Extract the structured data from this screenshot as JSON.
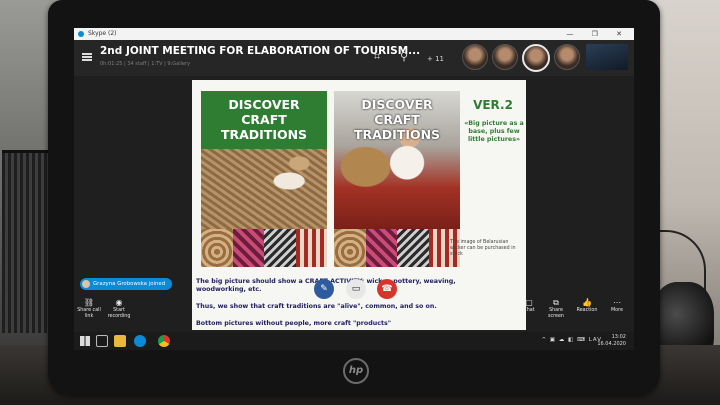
{
  "window": {
    "app_title": "Skype (2)",
    "controls": "— ❐ ✕"
  },
  "call": {
    "title": "2nd JOINT MEETING FOR ELABORATION OF TOURISM...",
    "subtitle": "0h:01:25 | 34 staff | 1:TV | 9:Gallery",
    "participants_count": "+ 11"
  },
  "slide": {
    "left_panel_title": "DISCOVER\nCRAFT\nTRADITIONS",
    "right_panel_title": "DISCOVER\nCRAFT\nTRADITIONS",
    "version": "VER.2",
    "version_note": "«Big picture as a base, plus few little pictures»",
    "stock_note": "The image of Belarusian wicker can be purchased in stock",
    "text_line_1": "The big picture should show a CRAFT ACTIVITY: wicker, pottery, weaving,",
    "text_line_2": "woodworking, etc.",
    "text_line_3": "Thus, we show that craft traditions are \"alive\", common, and so on.",
    "text_line_4": "Bottom pictures without people, more craft \"products\""
  },
  "notification": {
    "text": "Grazyna Grobowska joined"
  },
  "controls": {
    "share_link": "Share call\nlink",
    "start_recording": "Start\nrecording",
    "chat": "Chat",
    "share_screen": "Share\nscreen",
    "reaction": "Reaction",
    "more": "More"
  },
  "taskbar": {
    "tray": "^ ▣ ☁ ◧ ⌨ LAV",
    "time": "13:02",
    "date": "16.04.2020"
  },
  "brand": {
    "monitor_logo": "hp"
  },
  "colors": {
    "skype_blue": "#0a8bd6",
    "slide_green": "#2f7d33",
    "slide_red": "#b52a1f",
    "end_call_red": "#d9342b"
  }
}
